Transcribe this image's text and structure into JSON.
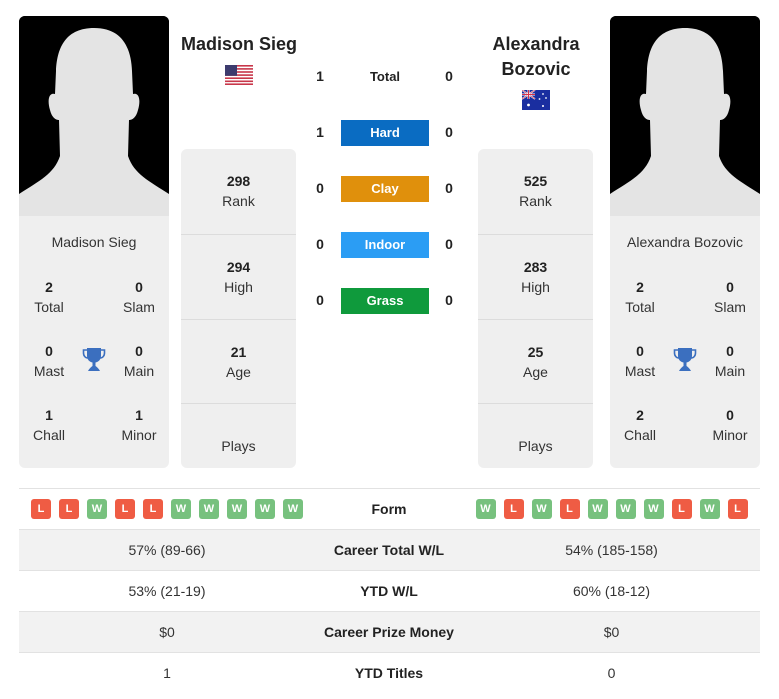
{
  "players": {
    "left": {
      "name": "Madison Sieg",
      "country_flag": "usa-flag-icon",
      "rank": "298",
      "rank_label": "Rank",
      "high": "294",
      "high_label": "High",
      "age": "21",
      "age_label": "Age",
      "plays_label": "Plays",
      "titles": {
        "total": "2",
        "total_label": "Total",
        "slam": "0",
        "slam_label": "Slam",
        "mast": "0",
        "mast_label": "Mast",
        "main": "0",
        "main_label": "Main",
        "chall": "1",
        "chall_label": "Chall",
        "minor": "1",
        "minor_label": "Minor"
      },
      "form": [
        "L",
        "L",
        "W",
        "L",
        "L",
        "W",
        "W",
        "W",
        "W",
        "W"
      ]
    },
    "right": {
      "name": "Alexandra Bozovic",
      "name_line1": "Alexandra",
      "name_line2": "Bozovic",
      "country_flag": "australia-flag-icon",
      "rank": "525",
      "rank_label": "Rank",
      "high": "283",
      "high_label": "High",
      "age": "25",
      "age_label": "Age",
      "plays_label": "Plays",
      "titles": {
        "total": "2",
        "total_label": "Total",
        "slam": "0",
        "slam_label": "Slam",
        "mast": "0",
        "mast_label": "Mast",
        "main": "0",
        "main_label": "Main",
        "chall": "2",
        "chall_label": "Chall",
        "minor": "0",
        "minor_label": "Minor"
      },
      "form": [
        "W",
        "L",
        "W",
        "L",
        "W",
        "W",
        "W",
        "L",
        "W",
        "L"
      ]
    }
  },
  "h2h": [
    {
      "label": "Total",
      "left": "1",
      "right": "0",
      "color": ""
    },
    {
      "label": "Hard",
      "left": "1",
      "right": "0",
      "color": "#0a6cc2"
    },
    {
      "label": "Clay",
      "left": "0",
      "right": "0",
      "color": "#e0900c"
    },
    {
      "label": "Indoor",
      "left": "0",
      "right": "0",
      "color": "#2b9df4"
    },
    {
      "label": "Grass",
      "left": "0",
      "right": "0",
      "color": "#0f9a3c"
    }
  ],
  "comparison": {
    "form_label": "Form",
    "rows": [
      {
        "label": "Career Total W/L",
        "left": "57% (89-66)",
        "right": "54% (185-158)"
      },
      {
        "label": "YTD W/L",
        "left": "53% (21-19)",
        "right": "60% (18-12)"
      },
      {
        "label": "Career Prize Money",
        "left": "$0",
        "right": "$0"
      },
      {
        "label": "YTD Titles",
        "left": "1",
        "right": "0"
      }
    ]
  },
  "colors": {
    "win": "#77c17e",
    "loss": "#ef5c44",
    "trophy": "#3b6fbf"
  }
}
